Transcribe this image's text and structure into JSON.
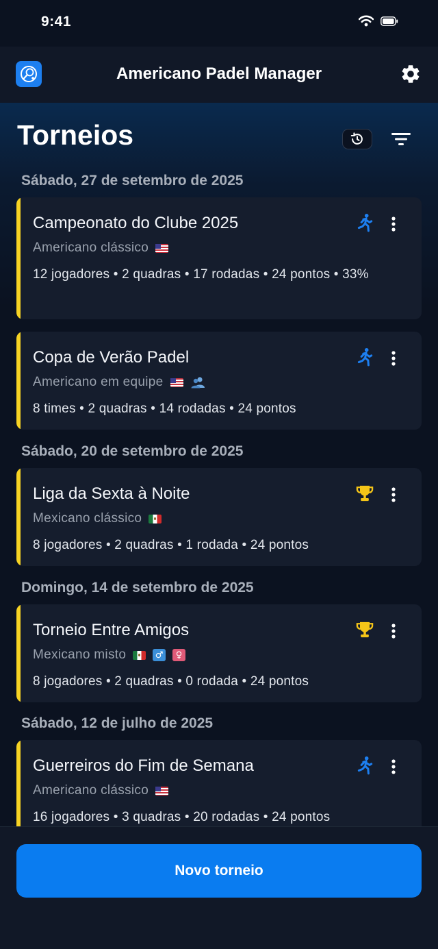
{
  "status_bar": {
    "time": "9:41"
  },
  "app_bar": {
    "title": "Americano Padel Manager"
  },
  "page": {
    "title": "Torneios"
  },
  "sections": [
    {
      "date": "Sábado, 27 de setembro de 2025"
    },
    {
      "date": "Sábado, 20 de setembro de 2025"
    },
    {
      "date": "Domingo, 14 de setembro de 2025"
    },
    {
      "date": "Sábado, 12 de julho de 2025"
    }
  ],
  "tournaments": [
    {
      "name": "Campeonato do Clube 2025",
      "type": "Americano clássico",
      "meta": "12 jogadores • 2 quadras • 17 rodadas • 24 pontos • 33%",
      "status_icon": "running-person-icon",
      "flags": [
        "us"
      ]
    },
    {
      "name": "Copa de Verão Padel",
      "type": "Americano em equipe",
      "meta": "8 times • 2 quadras • 14 rodadas • 24 pontos",
      "status_icon": "running-person-icon",
      "flags": [
        "us",
        "team"
      ]
    },
    {
      "name": "Liga da Sexta à Noite",
      "type": "Mexicano clássico",
      "meta": "8 jogadores • 2 quadras • 1 rodada • 24 pontos",
      "status_icon": "trophy-icon",
      "flags": [
        "mx"
      ]
    },
    {
      "name": "Torneio Entre Amigos",
      "type": "Mexicano misto",
      "meta": "8 jogadores • 2 quadras • 0 rodada • 24 pontos",
      "status_icon": "trophy-icon",
      "flags": [
        "mx",
        "male",
        "female"
      ]
    },
    {
      "name": "Guerreiros do Fim de Semana",
      "type": "Americano clássico",
      "meta": "16 jogadores • 3 quadras • 20 rodadas • 24 pontos",
      "status_icon": "running-person-icon",
      "flags": [
        "us"
      ]
    }
  ],
  "gender_symbols": {
    "male": "♂",
    "female": "♀"
  },
  "bottom": {
    "new_button_label": "Novo torneio"
  },
  "colors": {
    "accent_yellow": "#f7d323",
    "primary_blue": "#0a7cf0",
    "card_bg": "#151d2d",
    "running_icon": "#1d7ff0",
    "trophy_icon": "#f5c518"
  }
}
